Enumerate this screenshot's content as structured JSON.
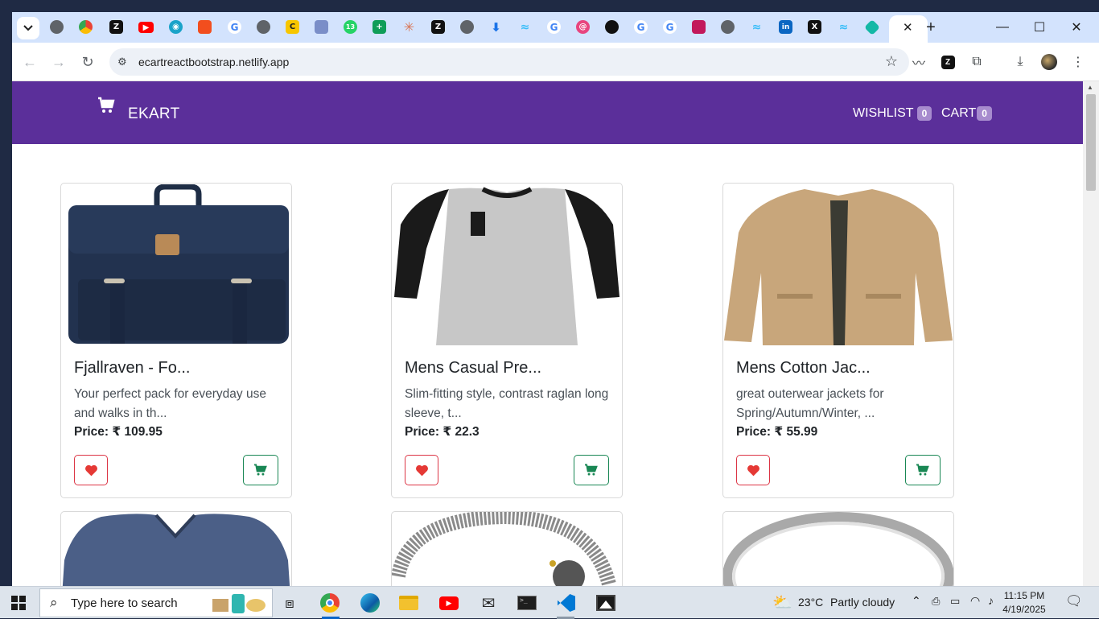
{
  "browser": {
    "url": "ecartreactbootstrap.netlify.app",
    "tab_favicons": [
      "chrome",
      "chrome",
      "zed",
      "youtube",
      "search",
      "figma",
      "google",
      "chrome",
      "c-app",
      "layers",
      "whatsapp",
      "sheets",
      "claude",
      "zed",
      "chrome",
      "download",
      "tailwind",
      "google",
      "swirl",
      "github",
      "google",
      "google",
      "calendar",
      "chrome",
      "tailwind",
      "linkedin",
      "x",
      "tailwind",
      "diamond"
    ],
    "whatsapp_count": "13"
  },
  "site": {
    "brand": "EKART",
    "nav": {
      "wishlist_label": "WISHLIST",
      "wishlist_count": "0",
      "cart_label": "CART",
      "cart_count": "0"
    }
  },
  "products": [
    {
      "title": "Fjallraven - Fo...",
      "description": "Your perfect pack for everyday use and walks in th...",
      "price": "Price: ₹ 109.95",
      "image": "navy-backpack"
    },
    {
      "title": "Mens Casual Pre...",
      "description": "Slim-fitting style, contrast raglan long sleeve, t...",
      "price": "Price: ₹ 22.3",
      "image": "raglan-tshirt"
    },
    {
      "title": "Mens Cotton Jac...",
      "description": "great outerwear jackets for Spring/Autumn/Winter, ...",
      "price": "Price: ₹ 55.99",
      "image": "khaki-jacket"
    }
  ],
  "products_row2": [
    {
      "image": "blue-vneck-shirt"
    },
    {
      "image": "dragon-bracelet"
    },
    {
      "image": "silver-ring"
    }
  ],
  "taskbar": {
    "search_placeholder": "Type here to search",
    "weather_temp": "23°C",
    "weather_desc": "Partly cloudy",
    "time": "11:15 PM",
    "date": "4/19/2025"
  },
  "colors": {
    "navbar": "#5b2f9a",
    "wishlist_red": "#dc3545",
    "cart_green": "#198754",
    "badge": "#a78bce"
  }
}
